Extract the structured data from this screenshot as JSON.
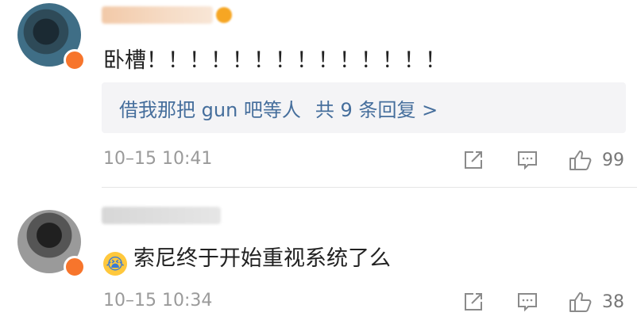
{
  "comments": [
    {
      "text": "卧槽！！！！！！！！！！！！！！",
      "reply_preview": "借我那把 gun 吧等人",
      "reply_more": "共 9 条回复 >",
      "time": "10–15 10:41",
      "likes": "99"
    },
    {
      "emoji": "😭",
      "text": "索尼终于开始重视系统了么",
      "time": "10–15 10:34",
      "likes": "38"
    }
  ],
  "icons": [
    "share-icon",
    "comment-icon",
    "like-icon",
    "emoji-crying-icon",
    "vip-icon"
  ],
  "colors": {
    "link": "#456e9c",
    "meta": "#9a9a9a",
    "reply_bg": "#f4f4f6",
    "badge": "#f7752c"
  }
}
